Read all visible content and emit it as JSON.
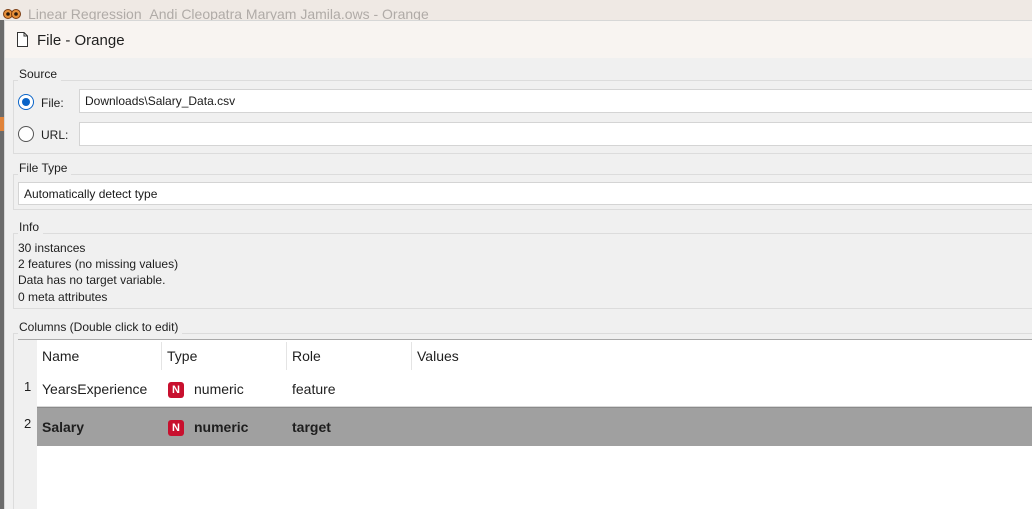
{
  "parent_window": {
    "title": "Linear Regression_Andi Cleopatra Maryam Jamila.ows - Orange",
    "icon": "orange-logo-icon"
  },
  "window": {
    "title": "File - Orange",
    "icon": "document-icon"
  },
  "source": {
    "label": "Source",
    "file_option": "File:",
    "file_value": "Downloads\\Salary_Data.csv",
    "url_option": "URL:",
    "url_value": "",
    "selected": "file"
  },
  "file_type": {
    "label": "File Type",
    "value": "Automatically detect type"
  },
  "info": {
    "label": "Info",
    "lines": [
      "30 instances",
      "2 features (no missing values)",
      "Data has no target variable.",
      "0 meta attributes"
    ]
  },
  "columns": {
    "label": "Columns (Double click to edit)",
    "headers": [
      "Name",
      "Type",
      "Role",
      "Values"
    ],
    "rows": [
      {
        "num": "1",
        "name": "YearsExperience",
        "type_badge": "N",
        "type": "numeric",
        "role": "feature",
        "values": "",
        "selected": false
      },
      {
        "num": "2",
        "name": "Salary",
        "type_badge": "N",
        "type": "numeric",
        "role": "target",
        "values": "",
        "selected": true
      }
    ]
  },
  "colors": {
    "radio_accent": "#0a64c8",
    "numeric_badge": "#c8102e",
    "selected_row": "#a0a0a0"
  }
}
